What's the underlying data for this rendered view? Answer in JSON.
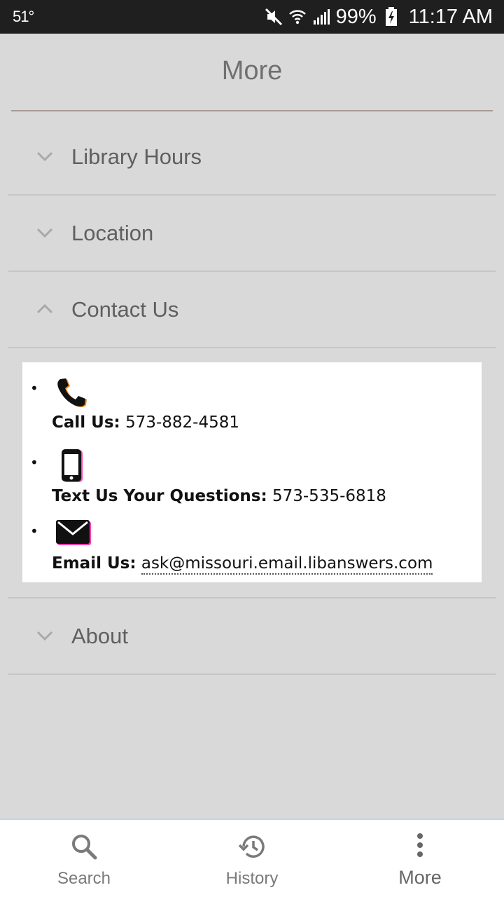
{
  "status_bar": {
    "temperature": "51°",
    "battery": "99%",
    "time": "11:17 AM",
    "icons": [
      "mute-icon",
      "wifi-icon",
      "signal-icon",
      "battery-charging-icon"
    ]
  },
  "header": {
    "title": "More"
  },
  "sections": [
    {
      "label": "Library Hours",
      "expanded": false
    },
    {
      "label": "Location",
      "expanded": false
    },
    {
      "label": "Contact Us",
      "expanded": true
    },
    {
      "label": "About",
      "expanded": false
    }
  ],
  "contact": {
    "call": {
      "label": "Call Us:",
      "value": "573-882-4581",
      "icon": "phone-icon"
    },
    "text": {
      "label": "Text Us Your Questions:",
      "value": "573-535-6818",
      "icon": "smartphone-icon"
    },
    "email": {
      "label": "Email Us:",
      "value": "ask@missouri.email.libanswers.com",
      "icon": "envelope-icon"
    }
  },
  "bottom_nav": {
    "items": [
      {
        "label": "Search",
        "icon": "search-icon"
      },
      {
        "label": "History",
        "icon": "history-icon"
      },
      {
        "label": "More",
        "icon": "more-vertical-icon",
        "active": true
      }
    ]
  },
  "colors": {
    "background": "#d9d9d9",
    "status_bar": "#1f1f1f",
    "panel": "#ffffff",
    "text": "#5f5f5f"
  }
}
